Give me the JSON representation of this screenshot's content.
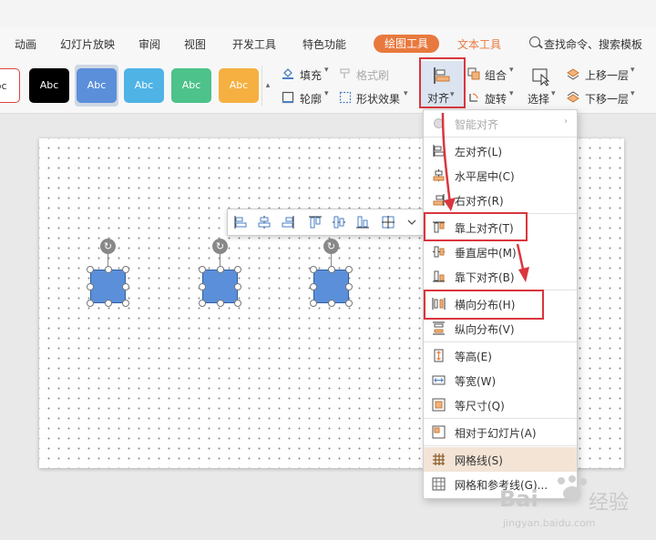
{
  "menubar": {
    "items": [
      "动画",
      "幻灯片放映",
      "审阅",
      "视图",
      "开发工具",
      "特色功能"
    ],
    "active_tab": "绘图工具",
    "text_tab": "文本工具",
    "search": "查找命令、搜索模板"
  },
  "styles": {
    "items": [
      "bc",
      "Abc",
      "Abc",
      "Abc",
      "Abc",
      "Abc"
    ],
    "colors": [
      "#ffffff",
      "#000000",
      "#5b8fd9",
      "#4fb3e6",
      "#4dc28a",
      "#f5b041"
    ]
  },
  "ribbon": {
    "fill": "填充",
    "format_painter": "格式刷",
    "outline": "轮廓",
    "shape_effect": "形状效果",
    "align": "对齐",
    "group": "组合",
    "rotate": "旋转",
    "select": "选择",
    "bring_forward": "上移一层",
    "send_backward": "下移一层"
  },
  "dropdown": {
    "items": [
      {
        "label": "智能对齐",
        "icon": "smart-align-icon",
        "disabled": true
      },
      {
        "label": "左对齐(L)",
        "icon": "align-left-icon"
      },
      {
        "label": "水平居中(C)",
        "icon": "align-center-icon"
      },
      {
        "label": "右对齐(R)",
        "icon": "align-right-icon"
      },
      {
        "label": "靠上对齐(T)",
        "icon": "align-top-icon"
      },
      {
        "label": "垂直居中(M)",
        "icon": "align-middle-icon"
      },
      {
        "label": "靠下对齐(B)",
        "icon": "align-bottom-icon"
      },
      {
        "label": "横向分布(H)",
        "icon": "distribute-horizontal-icon"
      },
      {
        "label": "纵向分布(V)",
        "icon": "distribute-vertical-icon"
      },
      {
        "label": "等高(E)",
        "icon": "same-height-icon"
      },
      {
        "label": "等宽(W)",
        "icon": "same-width-icon"
      },
      {
        "label": "等尺寸(Q)",
        "icon": "same-size-icon"
      },
      {
        "label": "相对于幻灯片(A)",
        "icon": "relative-slide-icon"
      },
      {
        "label": "网格线(S)",
        "icon": "gridlines-icon"
      },
      {
        "label": "网格和参考线(G)...",
        "icon": "grid-guides-icon"
      }
    ]
  },
  "watermark": {
    "brand": "Bai",
    "brand_suffix": "经验",
    "url": "jingyan.baidu.com"
  },
  "colors": {
    "accent": "#e8793e",
    "highlight": "#d9363e",
    "shape_fill": "#5b8fd9"
  }
}
